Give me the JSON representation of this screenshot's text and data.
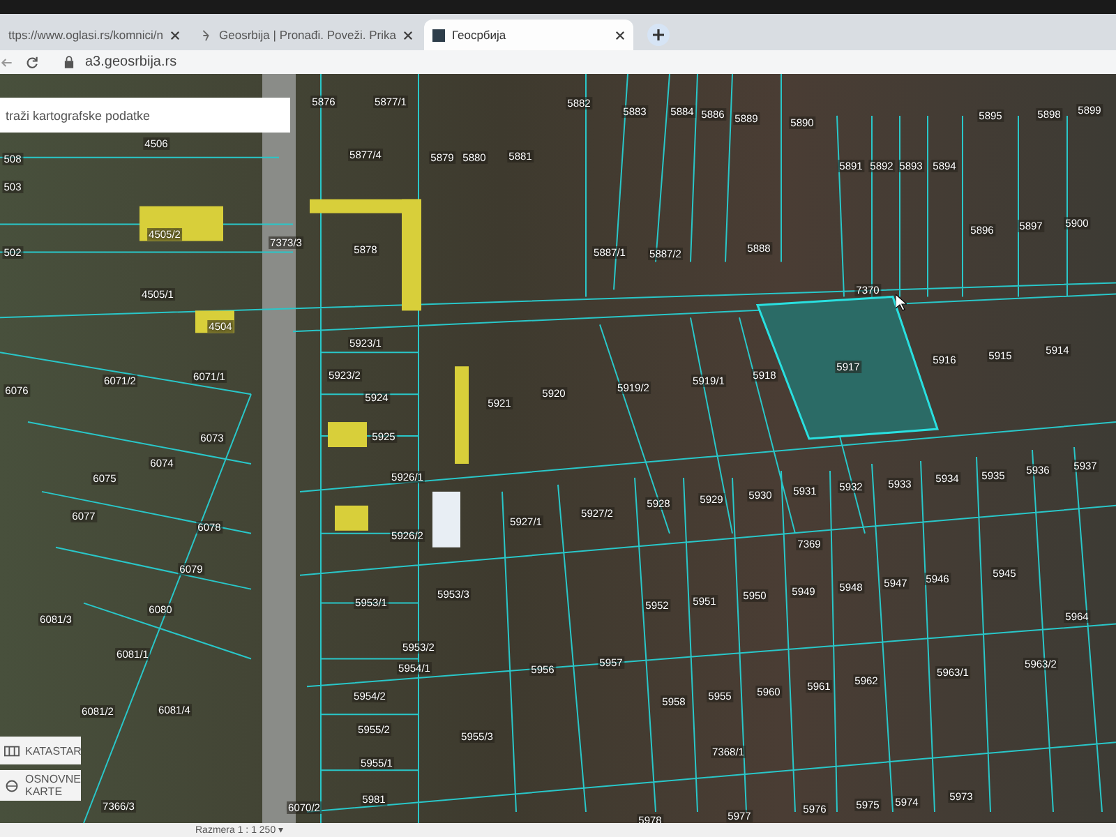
{
  "browser": {
    "tabs": [
      {
        "title": "ttps://www.oglasi.rs/komnici/n",
        "selected": false
      },
      {
        "title": "Geosrbija | Pronađi. Poveži. Prika",
        "selected": false
      },
      {
        "title": "Геосрбија",
        "selected": true
      }
    ],
    "address": "a3.geosrbija.rs"
  },
  "search": {
    "placeholder": "traži kartografske podatke"
  },
  "map": {
    "parcel_labels": [
      "5876",
      "5877/1",
      "5877/4",
      "4506",
      "508",
      "503",
      "502",
      "4505/2",
      "7373/3",
      "5878",
      "4505/1",
      "4504",
      "5923/1",
      "5923/2",
      "5924",
      "6076",
      "6071/2",
      "6071/1",
      "6073",
      "6074",
      "6075",
      "6077",
      "6078",
      "6079",
      "6080",
      "6081/3",
      "6081/1",
      "6081/2",
      "6081/4",
      "5925",
      "5926/1",
      "5926/2",
      "5953/1",
      "5953/2",
      "5954/1",
      "5954/2",
      "5955/2",
      "5955/1",
      "5981",
      "7366/3",
      "6070/2",
      "5879",
      "5880",
      "5881",
      "5882",
      "5883",
      "5884",
      "5886",
      "5889",
      "5890",
      "5891",
      "5892",
      "5893",
      "5894",
      "5895",
      "5898",
      "5899",
      "5887/1",
      "5887/2",
      "5888",
      "5896",
      "5897",
      "5900",
      "7370",
      "5917",
      "5916",
      "5915",
      "5914",
      "5919/2",
      "5919/1",
      "5918",
      "5920",
      "5921",
      "5927/1",
      "5927/2",
      "5928",
      "5929",
      "5930",
      "5931",
      "5932",
      "5933",
      "5934",
      "5935",
      "5936",
      "5937",
      "7369",
      "5953/3",
      "5956",
      "5957",
      "5952",
      "5951",
      "5950",
      "5949",
      "5948",
      "5947",
      "5946",
      "5945",
      "5964",
      "5963/2",
      "5963/1",
      "5958",
      "5955",
      "5960",
      "5961",
      "5962",
      "5955/3",
      "7368/1",
      "5978",
      "5977",
      "5976",
      "5975",
      "5974",
      "5973"
    ],
    "layer_buttons": [
      "KATASTAR",
      "OSNOVNE KARTE"
    ]
  },
  "status_bar": {
    "scale": "Razmera 1 : 1 250 ▾"
  }
}
